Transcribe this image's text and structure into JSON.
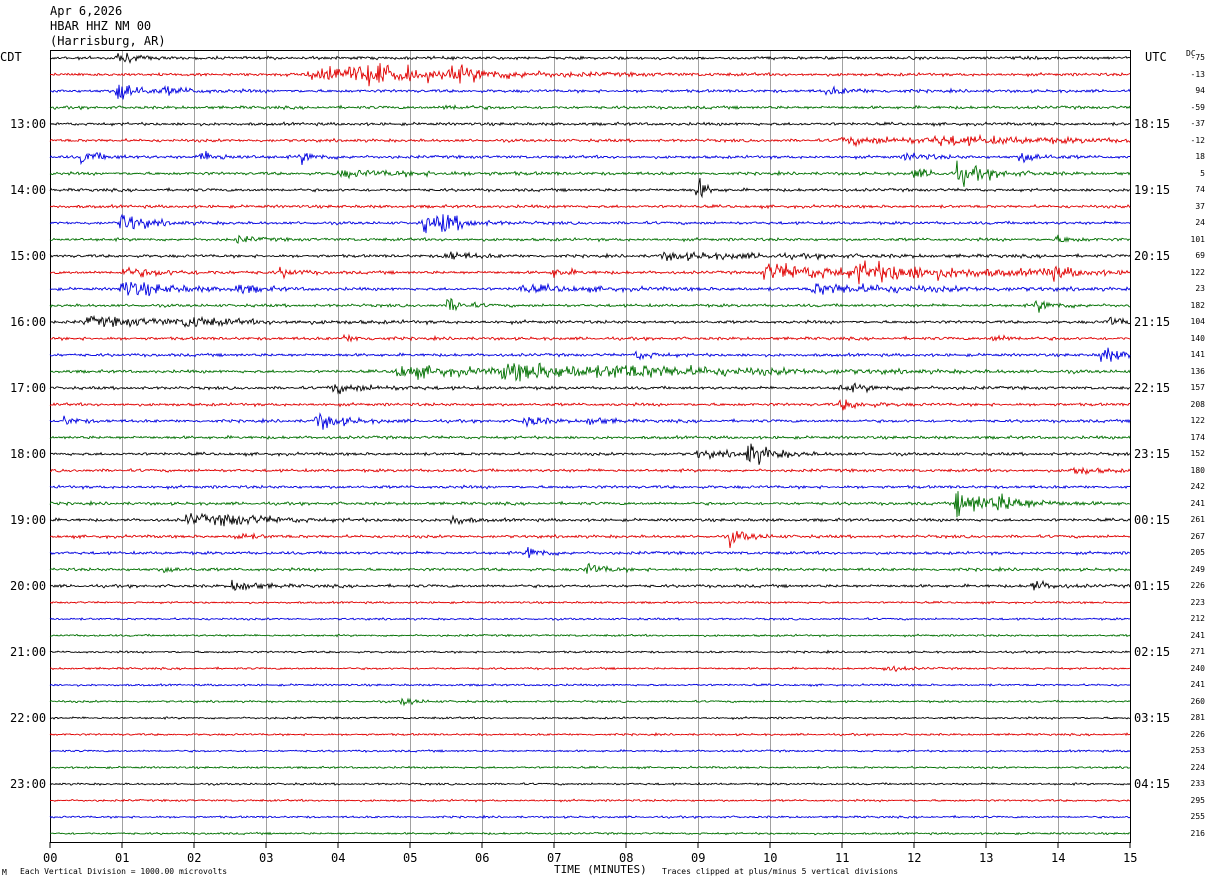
{
  "header": {
    "date": "Apr 6,2026",
    "station": "HBAR HHZ NM 00",
    "location": "(Harrisburg, AR)"
  },
  "left_tz": "CDT",
  "right_tz": "UTC",
  "dc_header": "DC",
  "footer": {
    "scale": "Each Vertical Division = 1000.00 microvolts",
    "xlabel": "TIME (MINUTES)",
    "clip": "Traces clipped at plus/minus 5 vertical divisions",
    "corner": "M"
  },
  "chart_data": {
    "type": "line",
    "title": "HBAR HHZ NM 00",
    "xlabel": "TIME (MINUTES)",
    "xlim": [
      0,
      15
    ],
    "x_ticks": [
      "00",
      "01",
      "02",
      "03",
      "04",
      "05",
      "06",
      "07",
      "08",
      "09",
      "10",
      "11",
      "12",
      "13",
      "14",
      "15"
    ],
    "grid": true,
    "trace_count": 48,
    "minutes_per_trace": 15,
    "trace_colors": [
      "#000000",
      "#e00000",
      "#0000e0",
      "#007000"
    ],
    "cdt_hour_labels": [
      "13:00",
      "14:00",
      "15:00",
      "16:00",
      "17:00",
      "18:00",
      "19:00",
      "20:00",
      "21:00",
      "22:00",
      "23:00"
    ],
    "utc_hour_labels": [
      "18:15",
      "19:15",
      "20:15",
      "21:15",
      "22:15",
      "23:15",
      "00:15",
      "01:15",
      "02:15",
      "03:15",
      "04:15"
    ],
    "dc_offsets": [
      "-75",
      "-13",
      "94",
      "-59",
      "-37",
      "-12",
      "18",
      "5",
      "74",
      "37",
      "24",
      "101",
      "69",
      "122",
      "23",
      "182",
      "104",
      "140",
      "141",
      "136",
      "157",
      "208",
      "122",
      "174",
      "152",
      "180",
      "242",
      "241",
      "261",
      "267",
      "205",
      "249",
      "226",
      "223",
      "212",
      "241",
      "271",
      "240",
      "241",
      "260",
      "281",
      "226",
      "253",
      "224",
      "233",
      "295",
      "255",
      "216"
    ],
    "events": [
      [
        [
          0.95,
          6,
          16,
          0.8
        ]
      ],
      [
        [
          3.6,
          10,
          50,
          2.0
        ],
        [
          4.4,
          5,
          30,
          1.5
        ],
        [
          5.6,
          4,
          30,
          1.5
        ]
      ],
      [
        [
          0.95,
          14,
          10,
          1.5
        ],
        [
          1.6,
          3,
          20,
          1.5
        ],
        [
          10.8,
          3,
          20,
          1.5
        ]
      ],
      [
        [
          5.5,
          2,
          20,
          1.0
        ]
      ],
      [],
      [
        [
          11.0,
          3,
          70,
          2.0
        ],
        [
          12.3,
          3,
          50,
          2.0
        ]
      ],
      [
        [
          0.45,
          6,
          16,
          1.0
        ],
        [
          2.1,
          5,
          20,
          1.0
        ],
        [
          3.5,
          5,
          16,
          1.0
        ],
        [
          11.9,
          4,
          20,
          1.0
        ],
        [
          13.5,
          6,
          16,
          1.0
        ]
      ],
      [
        [
          4.0,
          3,
          40,
          2.0
        ],
        [
          12.0,
          4,
          20,
          1.0
        ],
        [
          12.6,
          9,
          30,
          1.0
        ]
      ],
      [
        [
          9.0,
          12,
          8,
          0.8
        ]
      ],
      [],
      [
        [
          1.0,
          10,
          20,
          1.0
        ],
        [
          5.2,
          8,
          20,
          1.0
        ],
        [
          5.45,
          7,
          20,
          1.0
        ]
      ],
      [
        [
          2.6,
          3,
          16,
          1.0
        ],
        [
          14.0,
          3,
          16,
          1.0
        ]
      ],
      [
        [
          5.5,
          5,
          20,
          1.0
        ],
        [
          8.5,
          3,
          60,
          2.0
        ]
      ],
      [
        [
          1.0,
          4,
          30,
          1.5
        ],
        [
          3.2,
          4,
          16,
          1.0
        ],
        [
          7.0,
          4,
          16,
          1.0
        ],
        [
          9.9,
          8,
          50,
          2.0
        ],
        [
          11.2,
          7,
          50,
          2.0
        ],
        [
          13.8,
          7,
          20,
          1.0
        ]
      ],
      [
        [
          1.0,
          8,
          30,
          1.5
        ],
        [
          2.6,
          4,
          20,
          1.0
        ],
        [
          6.5,
          3,
          40,
          2.0
        ],
        [
          10.6,
          5,
          50,
          2.0
        ]
      ],
      [
        [
          5.55,
          8,
          12,
          1.0
        ],
        [
          13.7,
          5,
          20,
          1.0
        ]
      ],
      [
        [
          0.5,
          4,
          60,
          2.0
        ],
        [
          1.9,
          5,
          20,
          1.0
        ],
        [
          14.7,
          5,
          16,
          1.0
        ]
      ],
      [
        [
          4.1,
          3,
          16,
          1.0
        ],
        [
          13.1,
          3,
          16,
          1.0
        ]
      ],
      [
        [
          8.15,
          4,
          16,
          1.0
        ],
        [
          14.6,
          9,
          16,
          1.0
        ]
      ],
      [
        [
          4.8,
          6,
          40,
          2.0
        ],
        [
          6.3,
          7,
          80,
          2.0
        ],
        [
          7.8,
          3,
          50,
          2.0
        ]
      ],
      [
        [
          3.9,
          4,
          30,
          1.5
        ],
        [
          11.0,
          3,
          30,
          1.5
        ]
      ],
      [
        [
          11.0,
          5,
          20,
          1.0
        ]
      ],
      [
        [
          0.2,
          4,
          12,
          1.0
        ],
        [
          3.7,
          8,
          24,
          1.0
        ],
        [
          6.6,
          6,
          16,
          1.0
        ],
        [
          7.5,
          4,
          16,
          1.0
        ]
      ],
      [],
      [
        [
          9.0,
          3,
          30,
          1.5
        ],
        [
          9.7,
          10,
          20,
          1.0
        ]
      ],
      [
        [
          14.2,
          4,
          20,
          1.0
        ]
      ],
      [],
      [
        [
          12.6,
          12,
          40,
          1.0
        ],
        [
          13.2,
          5,
          20,
          1.0
        ]
      ],
      [
        [
          1.9,
          5,
          30,
          1.5
        ],
        [
          2.4,
          4,
          30,
          1.5
        ],
        [
          5.6,
          5,
          12,
          1.0
        ]
      ],
      [
        [
          2.6,
          3,
          16,
          1.0
        ],
        [
          9.45,
          7,
          16,
          1.0
        ]
      ],
      [
        [
          6.65,
          7,
          12,
          1.0
        ]
      ],
      [
        [
          1.6,
          3,
          12,
          1.0
        ],
        [
          7.45,
          6,
          16,
          1.0
        ]
      ],
      [
        [
          2.55,
          6,
          20,
          1.0
        ],
        [
          13.65,
          5,
          16,
          1.0
        ]
      ],
      [],
      [],
      [],
      [],
      [
        [
          11.6,
          4,
          12,
          1.0
        ]
      ],
      [],
      [
        [
          4.9,
          4,
          12,
          1.0
        ]
      ],
      [],
      [],
      [],
      [],
      [],
      [],
      [],
      []
    ]
  }
}
